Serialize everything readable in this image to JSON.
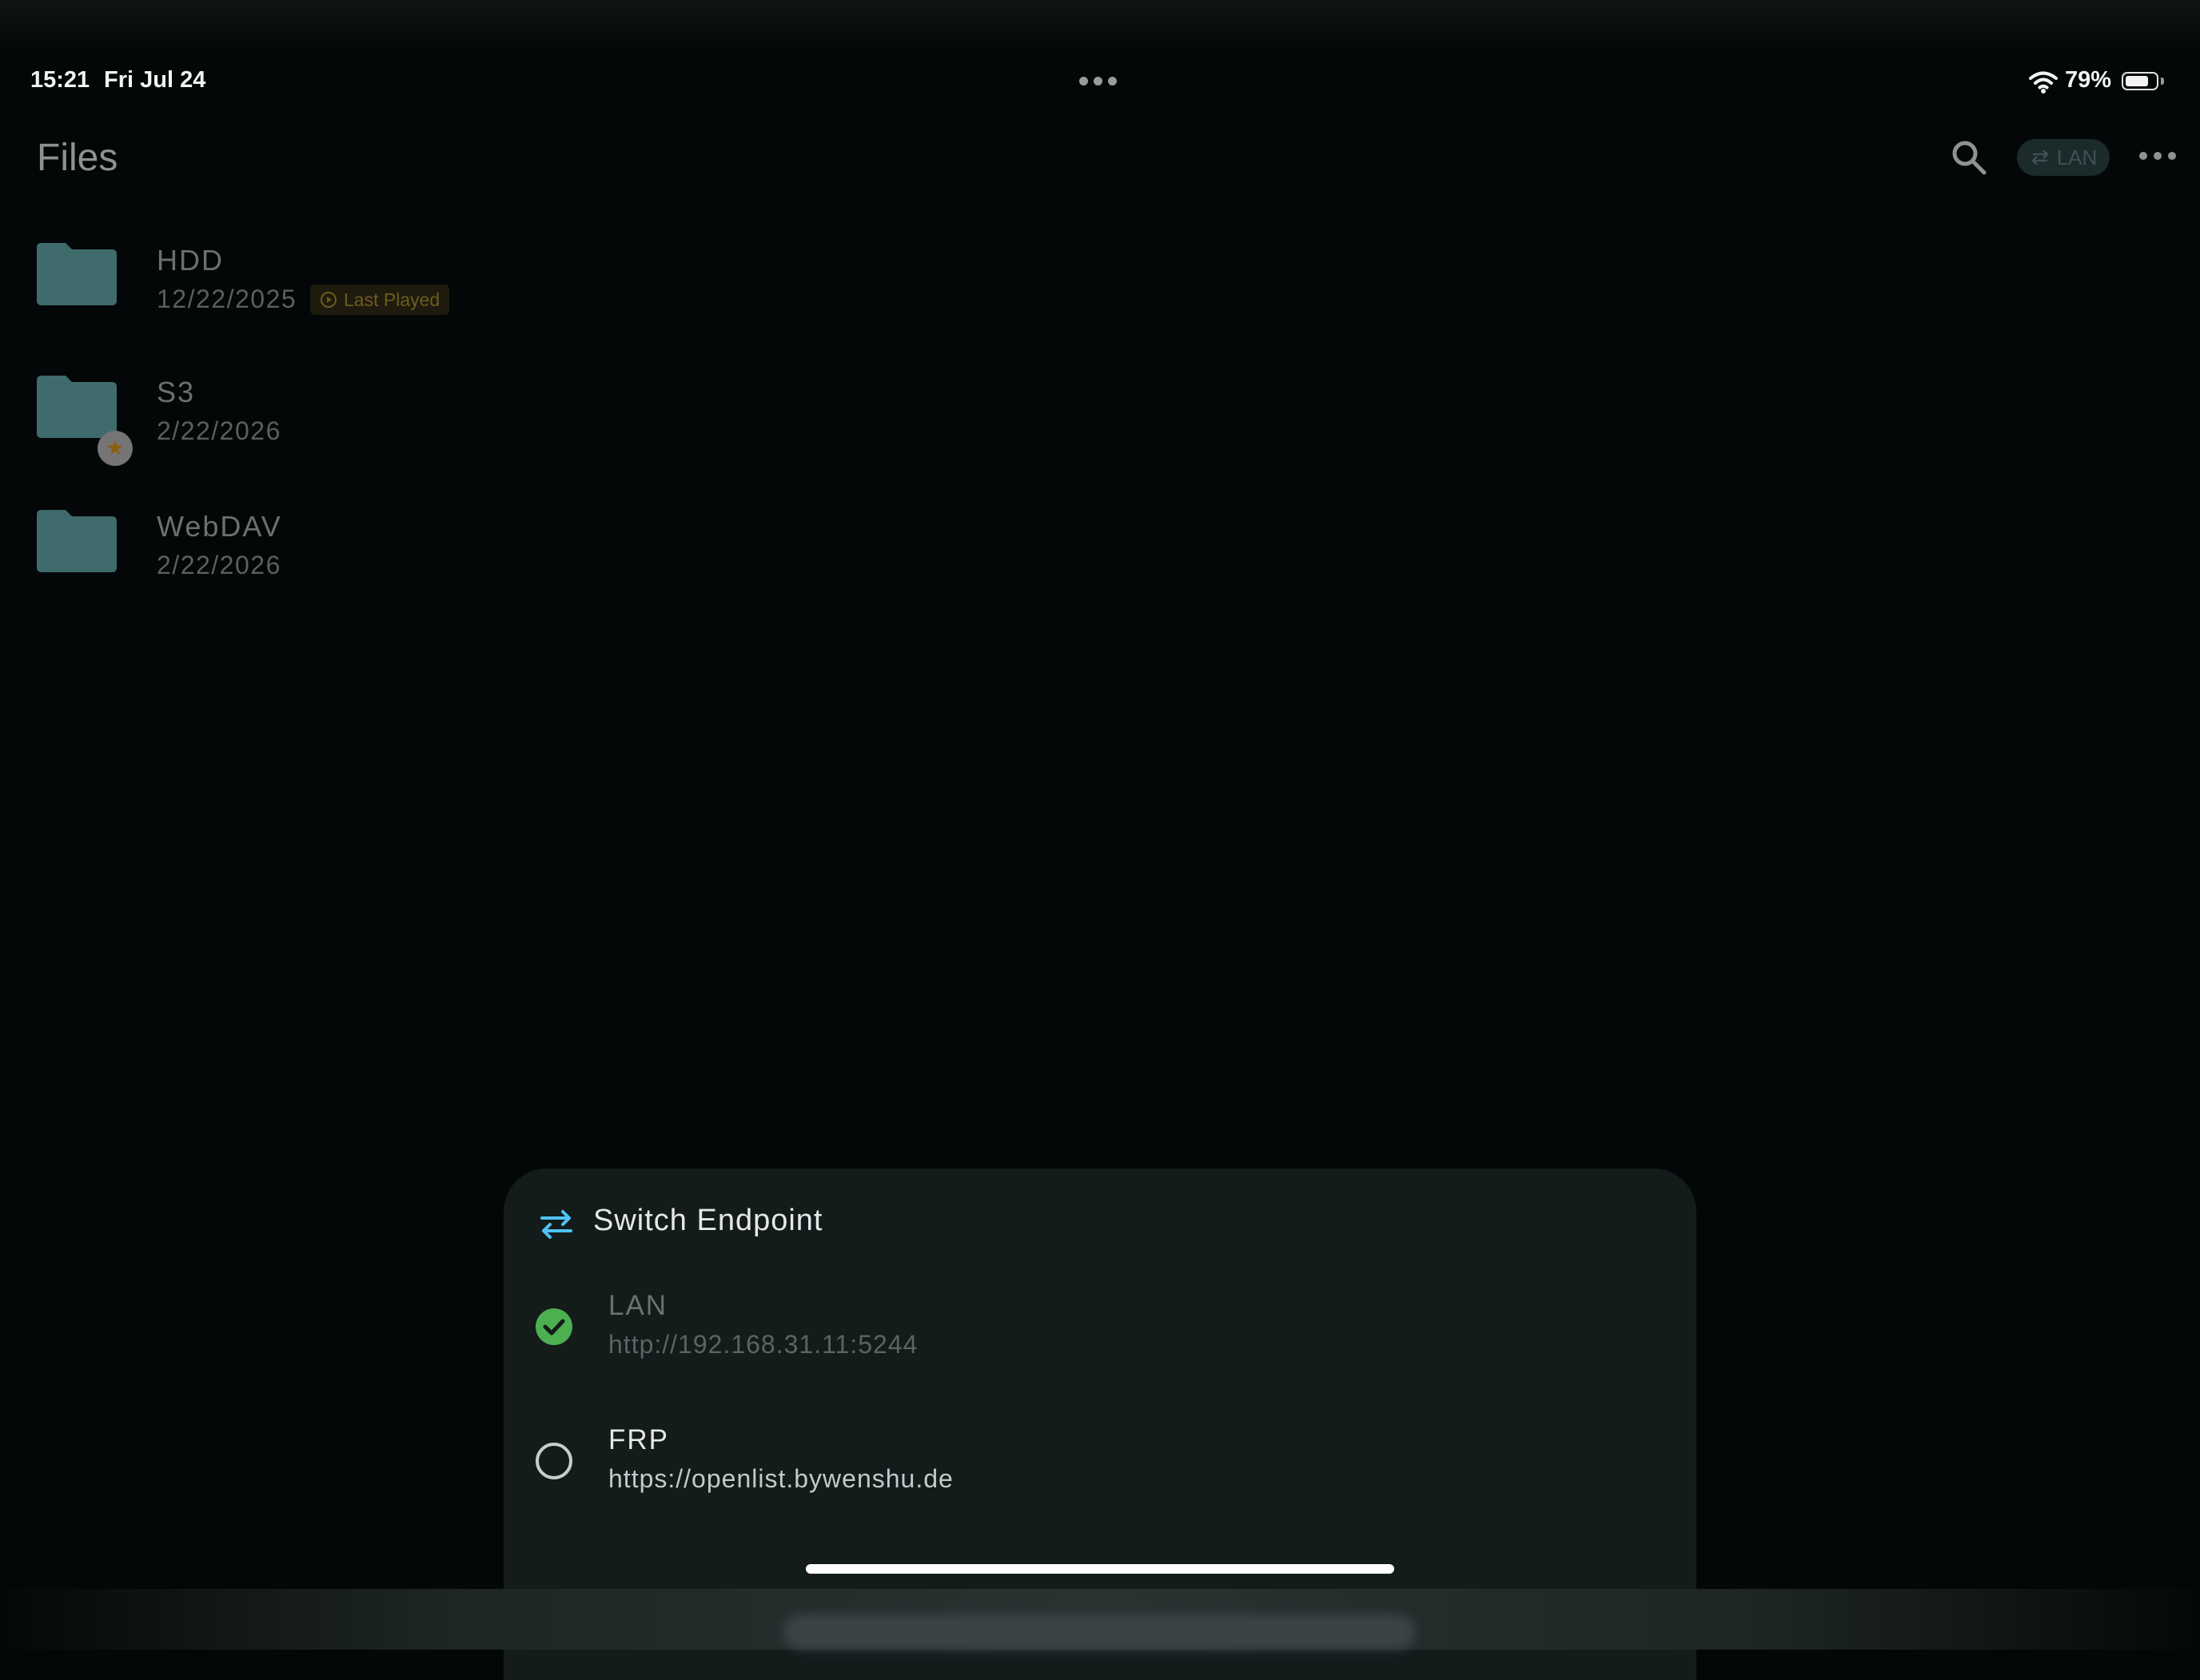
{
  "status_bar": {
    "time": "15:21",
    "date": "Fri Jul 24",
    "battery_percent": "79%",
    "battery_level": 0.79
  },
  "header": {
    "title": "Files",
    "search_icon": "search-icon",
    "endpoint_chip": {
      "label": "LAN",
      "icon": "switch-arrows-icon"
    },
    "more_icon": "more-horizontal-icon"
  },
  "files": [
    {
      "name": "HDD",
      "date": "12/22/2025",
      "badge": "Last Played"
    },
    {
      "name": "S3",
      "date": "2/22/2026",
      "favorite": true
    },
    {
      "name": "WebDAV",
      "date": "2/22/2026"
    }
  ],
  "sheet": {
    "title": "Switch Endpoint",
    "options": [
      {
        "name": "LAN",
        "url": "http://192.168.31.11:5244",
        "selected": true
      },
      {
        "name": "FRP",
        "url": "https://openlist.bywenshu.de",
        "selected": false
      }
    ]
  },
  "colors": {
    "accent_green": "#4caf50",
    "folder": "#3f6b6c",
    "sheet_bg": "#131b1b",
    "switch_icon": "#4fc3f7"
  }
}
